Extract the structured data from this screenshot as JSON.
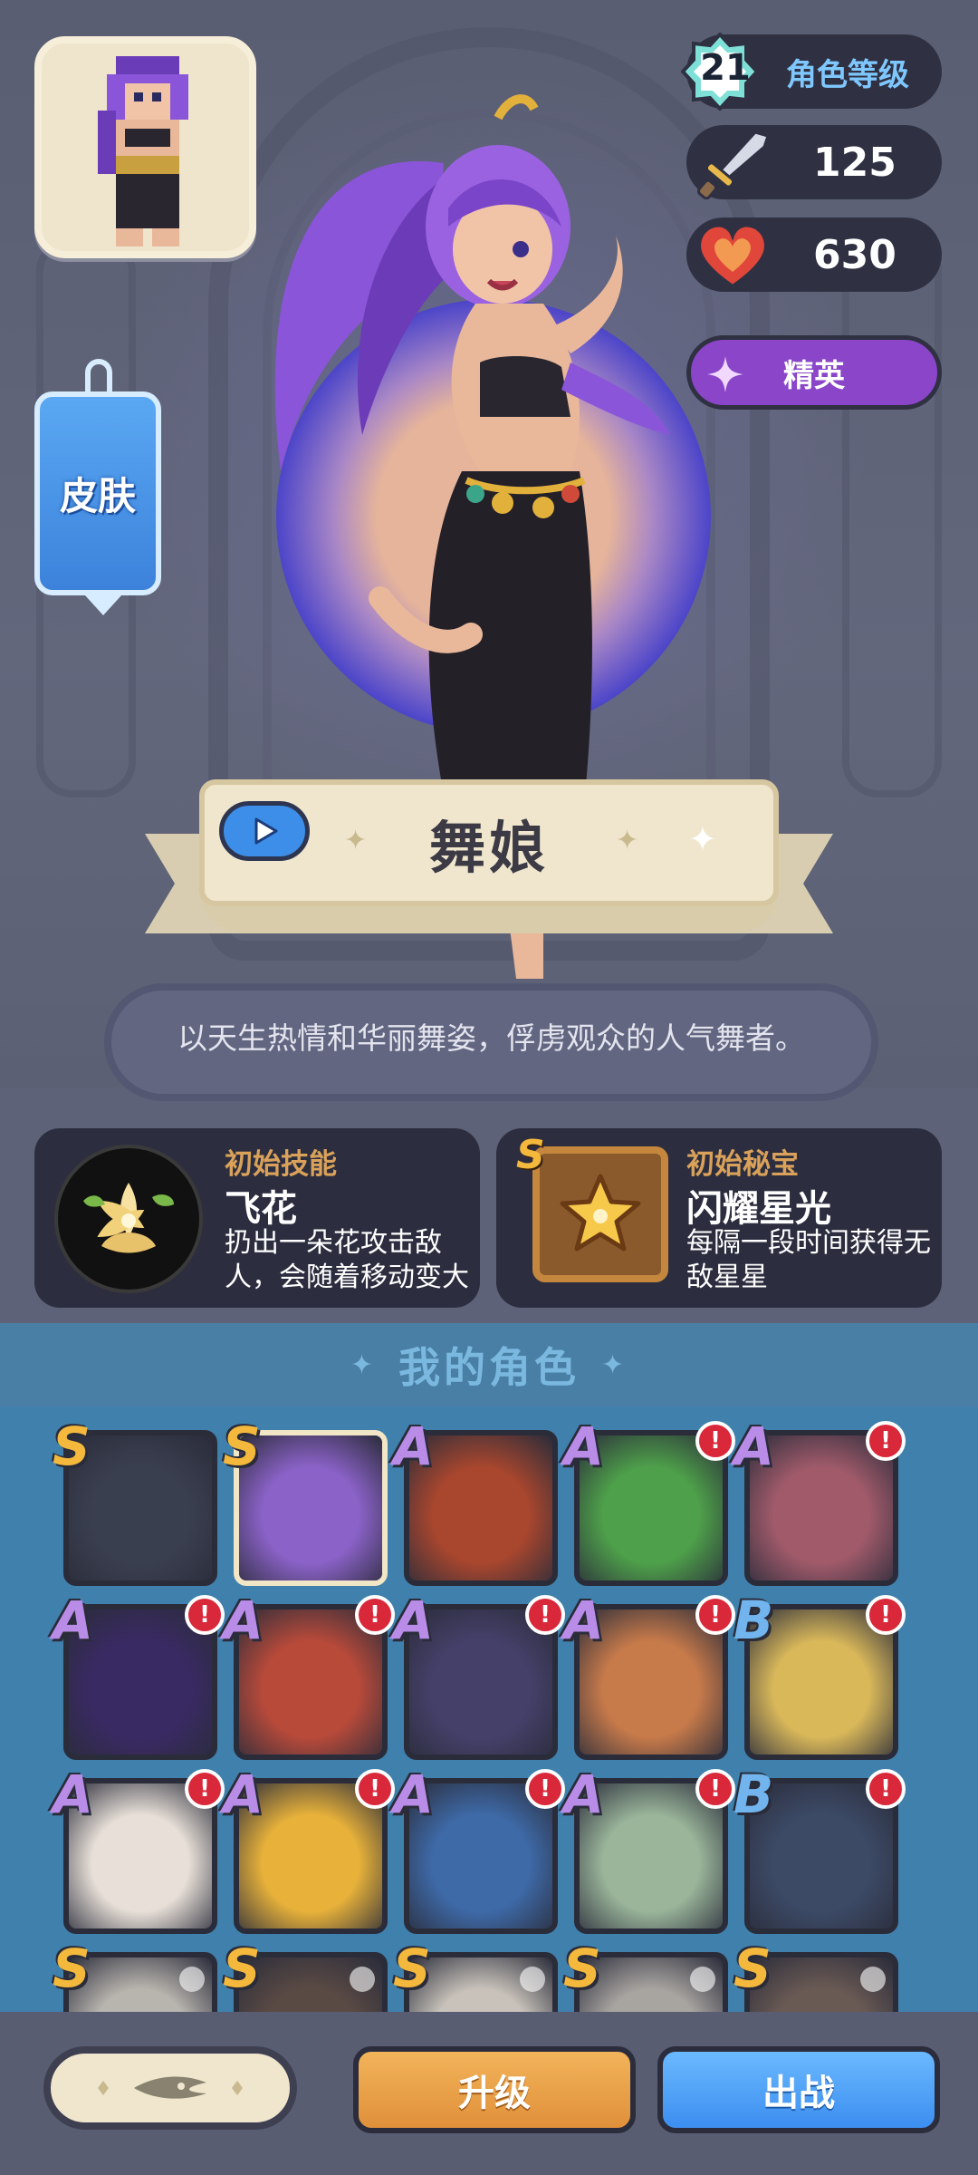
{
  "hero": {
    "name": "舞娘",
    "description": "以天生热情和华丽舞姿，俘虏观众的人气舞者。",
    "skin_label": "皮肤"
  },
  "stats": {
    "level": "21",
    "level_label": "角色等级",
    "attack": "125",
    "hp": "630",
    "rank": "精英"
  },
  "skill": {
    "subtitle": "初始技能",
    "name": "飞花",
    "text": "扔出一朵花攻击敌人，会随着移动变大"
  },
  "treasure": {
    "grade": "S",
    "subtitle": "初始秘宝",
    "name": "闪耀星光",
    "text": "每隔一段时间获得无敌星星"
  },
  "roster": {
    "title": "我的角色",
    "cards": [
      {
        "grade": "S",
        "alert": false,
        "selected": false,
        "locked": false,
        "color": "#3a3f4f"
      },
      {
        "grade": "S",
        "alert": false,
        "selected": true,
        "locked": false,
        "color": "#8b62c8"
      },
      {
        "grade": "A",
        "alert": false,
        "selected": false,
        "locked": false,
        "color": "#a8462e"
      },
      {
        "grade": "A",
        "alert": true,
        "selected": false,
        "locked": false,
        "color": "#4ea04a"
      },
      {
        "grade": "A",
        "alert": true,
        "selected": false,
        "locked": false,
        "color": "#a05a6a"
      },
      {
        "grade": "A",
        "alert": true,
        "selected": false,
        "locked": false,
        "color": "#3a2a64"
      },
      {
        "grade": "A",
        "alert": true,
        "selected": false,
        "locked": false,
        "color": "#b84a3a"
      },
      {
        "grade": "A",
        "alert": true,
        "selected": false,
        "locked": false,
        "color": "#45406a"
      },
      {
        "grade": "A",
        "alert": true,
        "selected": false,
        "locked": false,
        "color": "#c77a4a"
      },
      {
        "grade": "B",
        "alert": true,
        "selected": false,
        "locked": false,
        "color": "#d9b85a"
      },
      {
        "grade": "A",
        "alert": true,
        "selected": false,
        "locked": false,
        "color": "#e8e0d8"
      },
      {
        "grade": "A",
        "alert": true,
        "selected": false,
        "locked": false,
        "color": "#e8b23a"
      },
      {
        "grade": "A",
        "alert": true,
        "selected": false,
        "locked": false,
        "color": "#3e6aa8"
      },
      {
        "grade": "A",
        "alert": true,
        "selected": false,
        "locked": false,
        "color": "#9ab59a"
      },
      {
        "grade": "B",
        "alert": true,
        "selected": false,
        "locked": false,
        "color": "#3c4a66"
      },
      {
        "grade": "S",
        "alert": false,
        "selected": false,
        "locked": true,
        "color": "#b8b4ae"
      },
      {
        "grade": "S",
        "alert": false,
        "selected": false,
        "locked": true,
        "color": "#5a4a44"
      },
      {
        "grade": "S",
        "alert": false,
        "selected": false,
        "locked": true,
        "color": "#c8c2ba"
      },
      {
        "grade": "S",
        "alert": false,
        "selected": false,
        "locked": true,
        "color": "#a8a4a0"
      },
      {
        "grade": "S",
        "alert": false,
        "selected": false,
        "locked": true,
        "color": "#6a5a54"
      }
    ]
  },
  "buttons": {
    "upgrade": "升级",
    "deploy": "出战"
  },
  "colors": {
    "accent_gold": "#f4b93c",
    "rank_purple": "#8a45c8",
    "deploy_blue": "#3c8ef0",
    "upgrade_orange": "#e0903a"
  }
}
